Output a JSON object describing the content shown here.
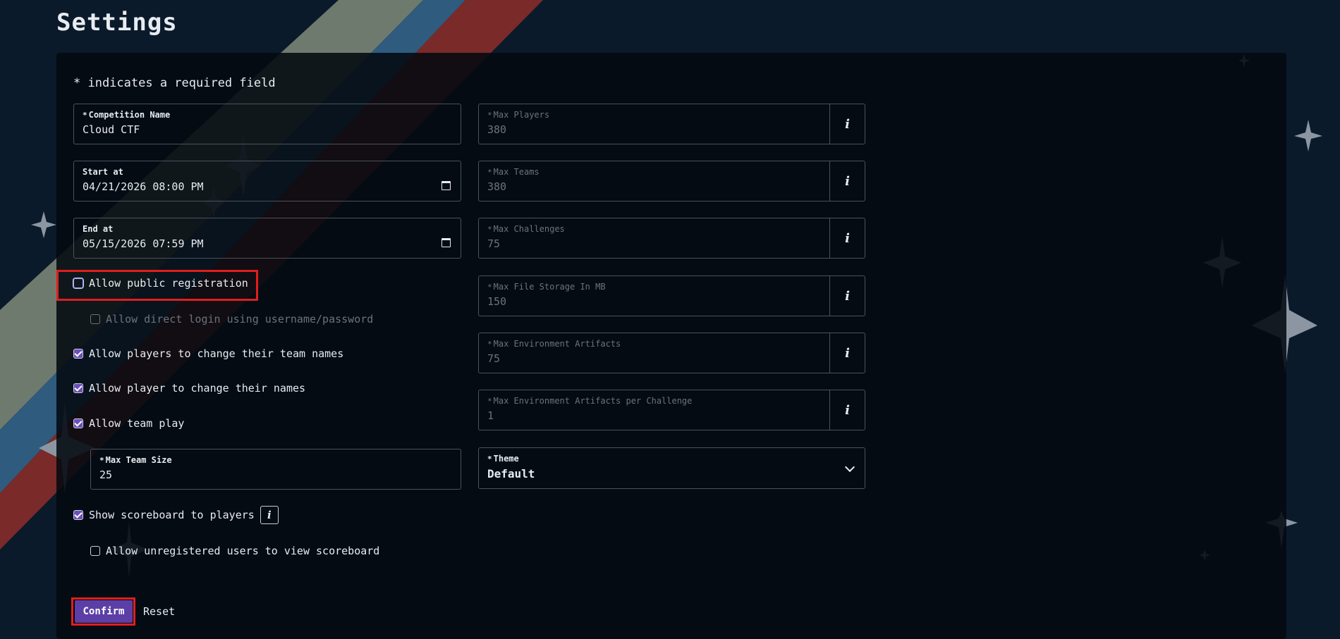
{
  "page": {
    "title": "Settings",
    "required_note": "* indicates a required field"
  },
  "left_fields": {
    "competition_name": {
      "label": "Competition Name",
      "value": "Cloud CTF"
    },
    "start_at": {
      "label": "Start at",
      "value": "04/21/2026 08:00 PM"
    },
    "end_at": {
      "label": "End at",
      "value": "05/15/2026 07:59 PM"
    }
  },
  "checkboxes": {
    "public_registration": {
      "label": "Allow public registration",
      "checked": false
    },
    "direct_login": {
      "label": "Allow direct login using username/password",
      "checked": false
    },
    "change_team_names": {
      "label": "Allow players to change their team names",
      "checked": true
    },
    "change_names": {
      "label": "Allow player to change their names",
      "checked": true
    },
    "team_play": {
      "label": "Allow team play",
      "checked": true
    },
    "show_scoreboard": {
      "label": "Show scoreboard to players",
      "checked": true
    },
    "unregistered_scoreboard": {
      "label": "Allow unregistered users to view scoreboard",
      "checked": false
    }
  },
  "max_team_size": {
    "label": "Max Team Size",
    "value": "25"
  },
  "right_fields": [
    {
      "label": "Max Players",
      "value": "380"
    },
    {
      "label": "Max Teams",
      "value": "380"
    },
    {
      "label": "Max Challenges",
      "value": "75"
    },
    {
      "label": "Max File Storage In MB",
      "value": "150"
    },
    {
      "label": "Max Environment Artifacts",
      "value": "75"
    },
    {
      "label": "Max Environment Artifacts per Challenge",
      "value": "1"
    }
  ],
  "theme": {
    "label": "Theme",
    "value": "Default"
  },
  "required_star": "*",
  "info_glyph": "i",
  "buttons": {
    "confirm": "Confirm",
    "reset": "Reset"
  },
  "colors": {
    "accent": "#5b3fa6",
    "highlight": "#e01e1e",
    "stripe_gray": "#6f7a6e",
    "stripe_blue": "#2e5b7e",
    "stripe_red": "#7a2a28"
  }
}
